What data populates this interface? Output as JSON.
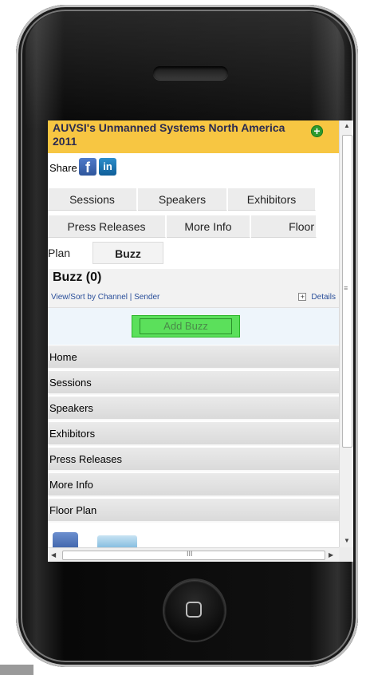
{
  "header": {
    "title": "AUVSI's Unmanned Systems North America 2011",
    "add_icon": "plus-circle-icon",
    "accent_color": "#f7c642"
  },
  "share": {
    "label": "Share",
    "facebook_icon": "f",
    "linkedin_icon": "in"
  },
  "tabs": [
    {
      "label": "Sessions"
    },
    {
      "label": "Speakers"
    },
    {
      "label": "Exhibitors"
    },
    {
      "label": "Press Releases"
    },
    {
      "label": "More Info"
    },
    {
      "label": "Floor"
    },
    {
      "label": "Plan"
    },
    {
      "label": "Buzz",
      "active": true
    }
  ],
  "buzz": {
    "title": "Buzz (0)",
    "sort_text": "View/Sort by Channel | Sender",
    "details_label": "Details",
    "add_button": "Add Buzz"
  },
  "menu": [
    {
      "label": "Home"
    },
    {
      "label": "Sessions"
    },
    {
      "label": "Speakers"
    },
    {
      "label": "Exhibitors"
    },
    {
      "label": "Press Releases"
    },
    {
      "label": "More Info"
    },
    {
      "label": "Floor Plan"
    }
  ],
  "scrollbar": {
    "grip": "≡",
    "hgrip": "III",
    "up": "▲",
    "down": "▼",
    "left": "◀",
    "right": "▶"
  }
}
